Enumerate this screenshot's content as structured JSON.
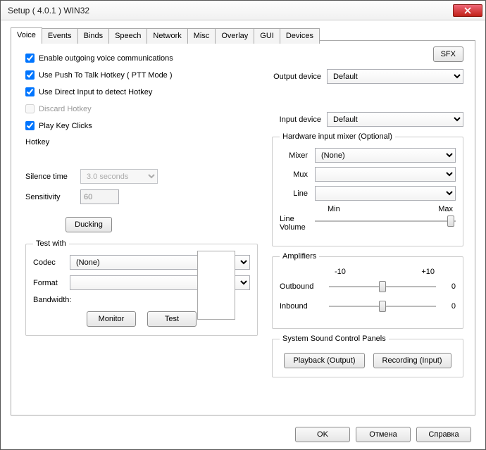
{
  "window": {
    "title": "Setup ( 4.0.1 ) WIN32"
  },
  "tabs": [
    "Voice",
    "Events",
    "Binds",
    "Speech",
    "Network",
    "Misc",
    "Overlay",
    "GUI",
    "Devices"
  ],
  "active_tab": 0,
  "voice": {
    "enable_out": "Enable outgoing voice communications",
    "ptt": "Use Push To Talk Hotkey ( PTT Mode )",
    "direct_input": "Use Direct Input to detect Hotkey",
    "discard": "Discard Hotkey",
    "play_clicks": "Play Key Clicks",
    "hotkey": "Hotkey",
    "silence_label": "Silence time",
    "silence_value": "3.0 seconds",
    "sens_label": "Sensitivity",
    "sens_value": "60",
    "ducking": "Ducking"
  },
  "test": {
    "legend": "Test with",
    "codec_label": "Codec",
    "codec_value": "(None)",
    "format_label": "Format",
    "bandwidth": "Bandwidth:",
    "monitor": "Monitor",
    "test": "Test"
  },
  "sfx": "SFX",
  "output": {
    "label": "Output device",
    "value": "Default"
  },
  "input": {
    "label": "Input device",
    "value": "Default"
  },
  "mixer": {
    "legend": "Hardware input mixer (Optional)",
    "mixer_label": "Mixer",
    "mixer_value": "(None)",
    "mux_label": "Mux",
    "line_label": "Line",
    "min": "Min",
    "max": "Max",
    "line_vol": "Line\nVolume"
  },
  "amp": {
    "legend": "Amplifiers",
    "lo": "-10",
    "hi": "+10",
    "out_label": "Outbound",
    "out_val": "0",
    "in_label": "Inbound",
    "in_val": "0"
  },
  "panels": {
    "legend": "System Sound Control Panels",
    "playback": "Playback (Output)",
    "recording": "Recording (Input)"
  },
  "footer": {
    "ok": "OK",
    "cancel": "Отмена",
    "help": "Справка"
  }
}
